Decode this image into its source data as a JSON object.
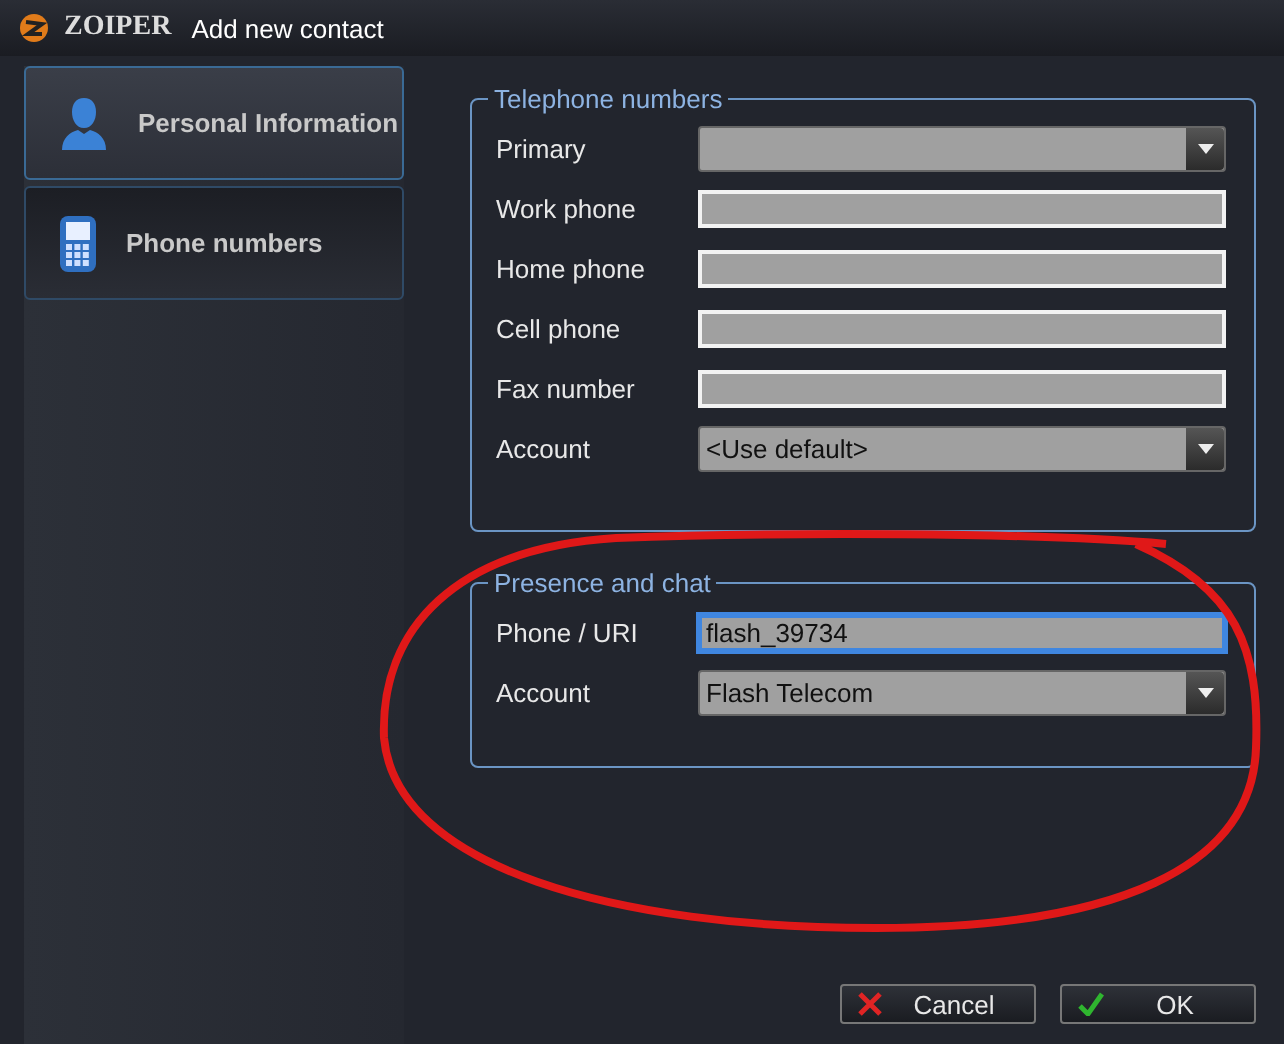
{
  "window": {
    "app_name": "ZOIPER",
    "title": "Add new contact"
  },
  "tabs": [
    {
      "label": "Personal Information",
      "selected": false
    },
    {
      "label": "Phone numbers",
      "selected": true
    }
  ],
  "groups": [
    {
      "title": "Telephone numbers",
      "fields": [
        {
          "label": "Primary",
          "kind": "dropdown"
        },
        {
          "label": "Work phone",
          "kind": "text",
          "focused": false
        },
        {
          "label": "Home phone",
          "kind": "text",
          "focused": false
        },
        {
          "label": "Cell phone",
          "kind": "text",
          "focused": false
        },
        {
          "label": "Fax number",
          "kind": "text",
          "focused": false
        },
        {
          "label": "Account",
          "kind": "dropdown",
          "value": "<Use default>"
        }
      ]
    },
    {
      "title": "Presence and chat",
      "fields": [
        {
          "label": "Phone / URI",
          "kind": "text",
          "value": "flash_39734",
          "focused": true
        },
        {
          "label": "Account",
          "kind": "dropdown",
          "value": "Flash Telecom"
        }
      ]
    }
  ],
  "buttons": [
    {
      "label": "Cancel",
      "kind": "cancel"
    },
    {
      "label": "OK",
      "kind": "ok"
    }
  ]
}
